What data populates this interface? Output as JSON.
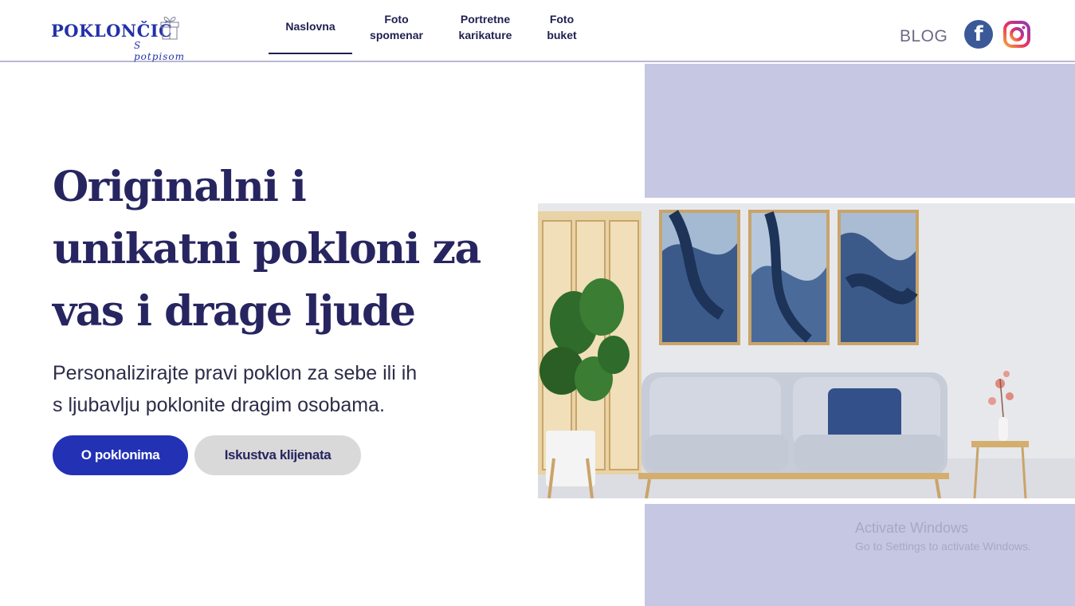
{
  "logo": {
    "main": "POKLONČIĆ",
    "sub": "S potpisom"
  },
  "nav": {
    "items": [
      {
        "label": "Naslovna",
        "active": true
      },
      {
        "label": "Foto\nspomenar",
        "active": false
      },
      {
        "label": "Portretne\nkarikature",
        "active": false
      },
      {
        "label": "Foto\nbuket",
        "active": false
      }
    ]
  },
  "header_right": {
    "blog": "BLOG",
    "facebook_icon": "f"
  },
  "hero": {
    "headline": "Originalni i\nunikatni pokloni za\nvas i drage ljude",
    "subtext": "Personalizirajte pravi poklon za sebe ili ih\ns ljubavlju poklonite dragim osobama.",
    "primary_button": "O poklonima",
    "secondary_button": "Iskustva klijenata"
  },
  "watermark": {
    "title": "Activate Windows",
    "subtitle": "Go to Settings to activate Windows."
  },
  "colors": {
    "accent": "#2331b5",
    "lavender": "#c6c7e3",
    "heading": "#272560"
  }
}
